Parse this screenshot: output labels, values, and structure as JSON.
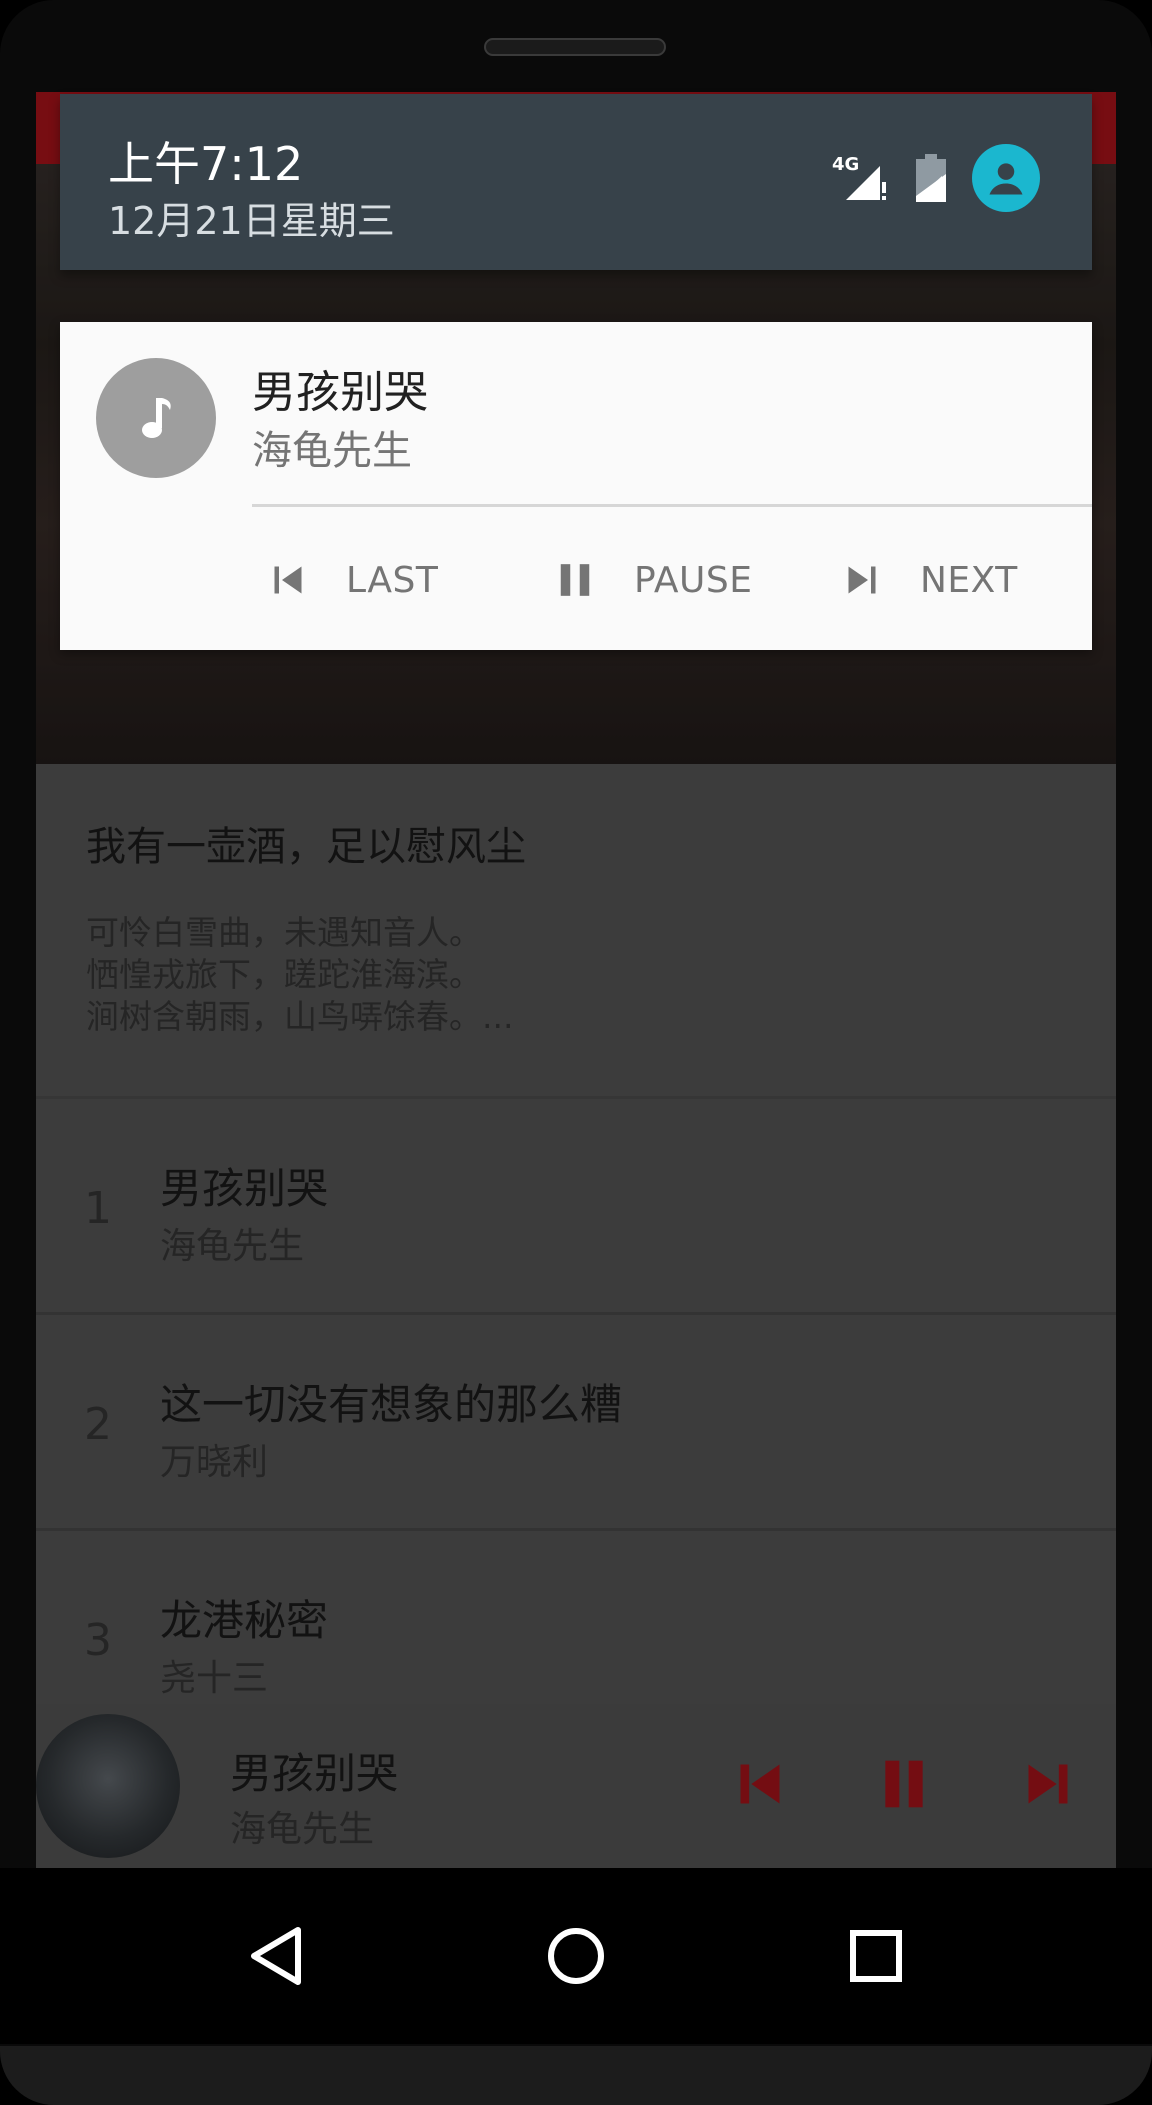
{
  "status_shade": {
    "time": "上午7:12",
    "date": "12月21日星期三",
    "network_label": "4G",
    "icons": [
      "signal-icon",
      "battery-icon",
      "account-icon"
    ]
  },
  "notification": {
    "icon": "music-note-icon",
    "title": "男孩别哭",
    "artist": "海龟先生",
    "actions": {
      "last": "LAST",
      "pause": "PAUSE",
      "next": "NEXT"
    }
  },
  "poem": {
    "title": "我有一壶酒，足以慰风尘",
    "lines": [
      "可怜白雪曲，未遇知音人。",
      "恓惶戎旅下，蹉跎淮海滨。",
      "涧树含朝雨，山鸟哢馀春。..."
    ]
  },
  "songs": [
    {
      "index": "1",
      "title": "男孩别哭",
      "artist": "海龟先生"
    },
    {
      "index": "2",
      "title": "这一切没有想象的那么糟",
      "artist": "万晓利"
    },
    {
      "index": "3",
      "title": "龙港秘密",
      "artist": "尧十三"
    }
  ],
  "mini_player": {
    "title": "男孩别哭",
    "artist": "海龟先生",
    "accent_color": "#b3141c"
  },
  "colors": {
    "notification_bg": "#fafafa",
    "shade_bg": "#37424a",
    "account_accent": "#1bb7cf",
    "app_topbar": "#b7141c"
  },
  "navigation": {
    "back": "back-icon",
    "home": "home-icon",
    "recents": "recents-icon"
  }
}
